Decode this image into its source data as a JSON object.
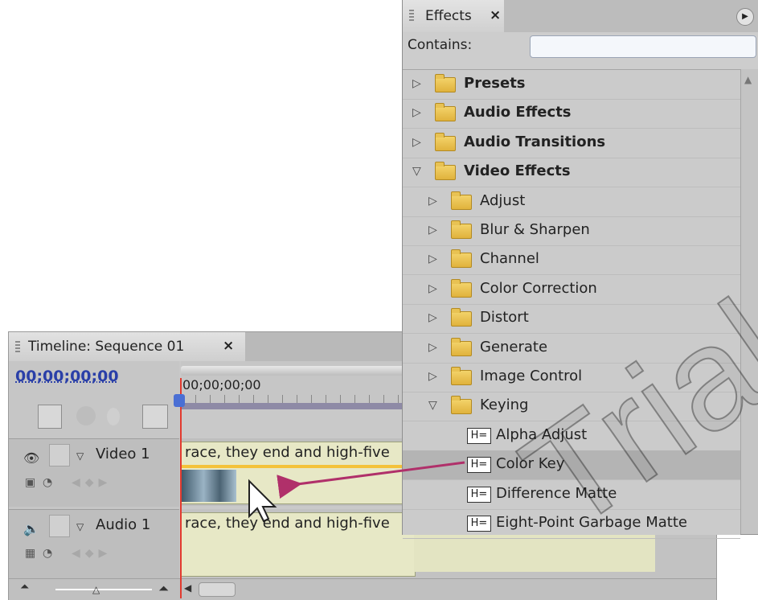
{
  "timeline": {
    "tab_title": "Timeline: Sequence 01",
    "close": "×",
    "timecode": "00;00;00;00",
    "ruler_time": "00;00;00;00",
    "video_track": {
      "name": "Video 1",
      "clip_label": "race, they end and high-five"
    },
    "audio_track": {
      "name": "Audio 1",
      "clip_label": "race, they end and high-five"
    }
  },
  "effects": {
    "tab_title": "Effects",
    "close": "×",
    "contains_label": "Contains:",
    "contains_value": "",
    "items": [
      {
        "label": "Presets",
        "level": 0,
        "expanded": false,
        "bold": true,
        "icon": "presets-folder-icon"
      },
      {
        "label": "Audio Effects",
        "level": 0,
        "expanded": false,
        "bold": true,
        "icon": "folder-icon"
      },
      {
        "label": "Audio Transitions",
        "level": 0,
        "expanded": false,
        "bold": true,
        "icon": "folder-icon"
      },
      {
        "label": "Video Effects",
        "level": 0,
        "expanded": true,
        "bold": true,
        "icon": "folder-icon"
      },
      {
        "label": "Adjust",
        "level": 1,
        "expanded": false,
        "icon": "folder-icon"
      },
      {
        "label": "Blur & Sharpen",
        "level": 1,
        "expanded": false,
        "icon": "folder-icon"
      },
      {
        "label": "Channel",
        "level": 1,
        "expanded": false,
        "icon": "folder-icon"
      },
      {
        "label": "Color Correction",
        "level": 1,
        "expanded": false,
        "icon": "folder-icon"
      },
      {
        "label": "Distort",
        "level": 1,
        "expanded": false,
        "icon": "folder-icon"
      },
      {
        "label": "Generate",
        "level": 1,
        "expanded": false,
        "icon": "folder-icon"
      },
      {
        "label": "Image Control",
        "level": 1,
        "expanded": false,
        "icon": "folder-icon"
      },
      {
        "label": "Keying",
        "level": 1,
        "expanded": true,
        "icon": "folder-icon"
      },
      {
        "label": "Alpha Adjust",
        "level": 2,
        "icon": "effect-icon"
      },
      {
        "label": "Color Key",
        "level": 2,
        "icon": "effect-icon",
        "selected": true
      },
      {
        "label": "Difference Matte",
        "level": 2,
        "icon": "effect-icon"
      },
      {
        "label": "Eight-Point Garbage Matte",
        "level": 2,
        "icon": "effect-icon"
      }
    ]
  },
  "watermark": "Trial",
  "colors": {
    "timecode": "#2a3fa8",
    "playhead": "#e23a2f",
    "drag_arrow": "#b0306a",
    "clip": "#e7e8c6"
  }
}
